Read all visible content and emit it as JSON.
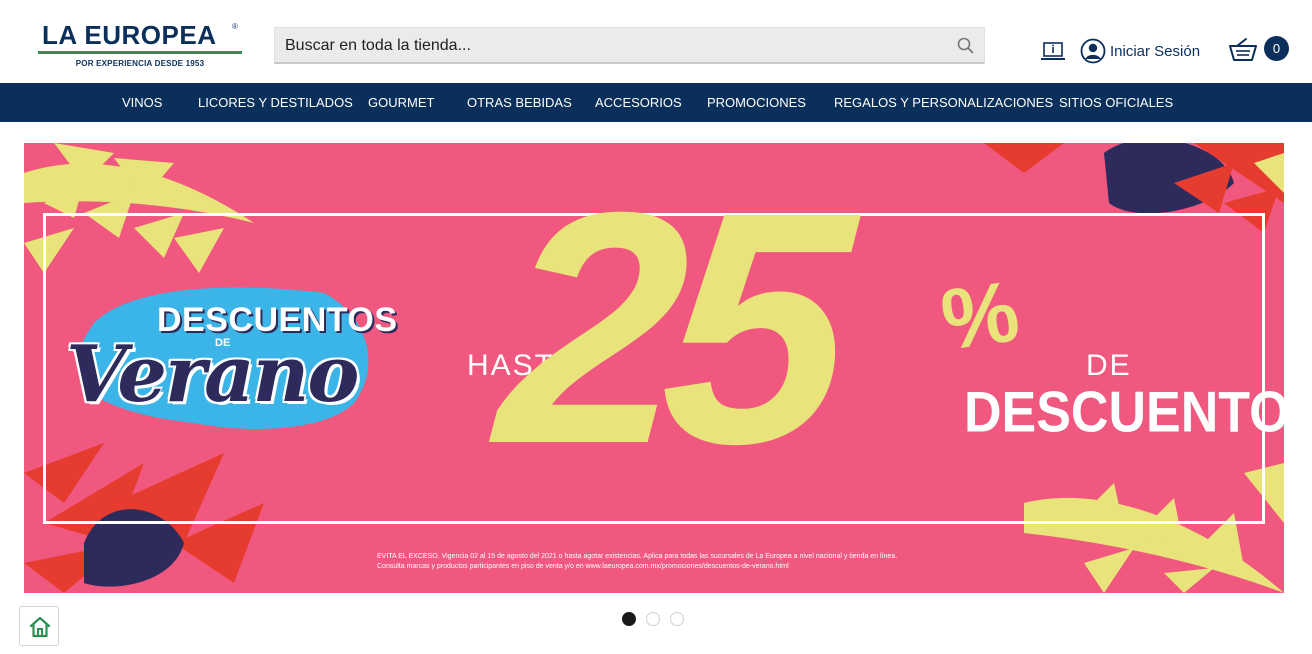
{
  "header": {
    "logo": {
      "name": "LA EUROPEA",
      "reg_mark": "®",
      "tagline": "POR EXPERIENCIA DESDE 1953"
    },
    "search": {
      "placeholder": "Buscar en toda la tienda...",
      "value": ""
    },
    "icons": {
      "laptop": "laptop-icon",
      "search": "search-icon",
      "user": "user-icon",
      "cart": "basket-icon"
    },
    "account_label": "Iniciar Sesión",
    "cart_count": "0"
  },
  "nav": {
    "items": [
      "VINOS",
      "LICORES Y DESTILADOS",
      "GOURMET",
      "OTRAS BEBIDAS",
      "ACCESORIOS",
      "PROMOCIONES",
      "REGALOS Y PERSONALIZACIONES",
      "SITIOS OFICIALES"
    ]
  },
  "banner": {
    "line1": "DESCUENTOS",
    "line2": "DE",
    "line3": "Verano",
    "hasta": "HASTA",
    "number": "25",
    "percent": "%",
    "de": "DE",
    "descuento": "DESCUENTO",
    "legal_1": "EVITA EL EXCESO. Vigencia 02 al 15 de agosto del 2021 o hasta agotar existencias. Aplica para todas las sucursales de La Europea a nivel nacional y tienda en línea.",
    "legal_2": "Consulta marcas y productos participantes en piso de venta y/o en www.laeuropea.com.mx/promociones/descuentos-de-verano.html"
  },
  "carousel": {
    "slides": 3,
    "active": 1
  },
  "colors": {
    "brand_navy": "#0b2f5b",
    "brand_green": "#2f8f55",
    "banner_pink": "#f0587f",
    "banner_yellow": "#e8e37a",
    "banner_navy": "#2c2b5c",
    "banner_blue": "#3bb5e8"
  },
  "home_button_icon": "home-icon"
}
